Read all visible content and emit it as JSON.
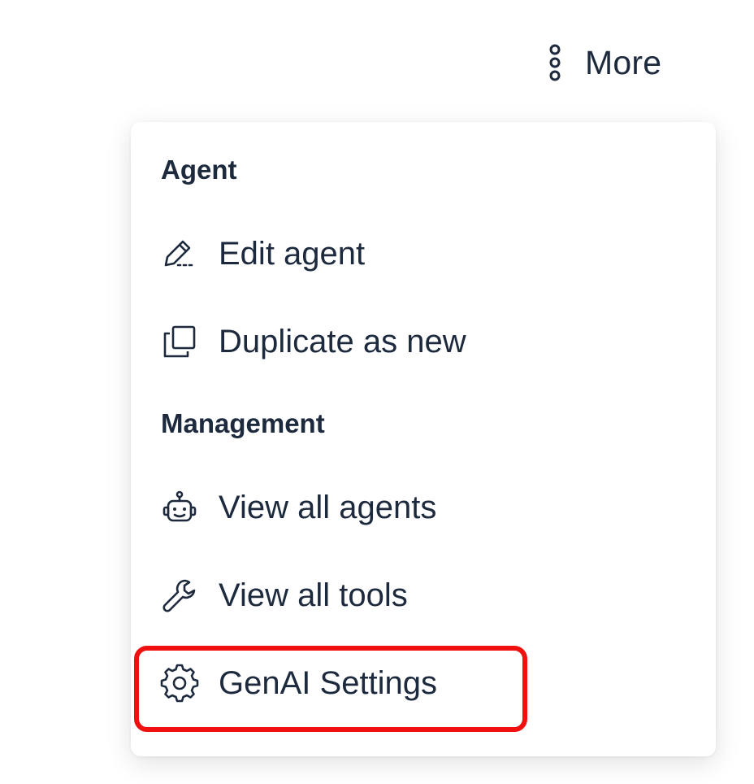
{
  "header": {
    "more_label": "More",
    "more_icon": "vertical-ellipsis-icon"
  },
  "menu": {
    "sections": [
      {
        "heading": "Agent",
        "items": [
          {
            "label": "Edit agent",
            "icon": "pencil-icon"
          },
          {
            "label": "Duplicate as new",
            "icon": "copy-icon"
          }
        ]
      },
      {
        "heading": "Management",
        "items": [
          {
            "label": "View all agents",
            "icon": "robot-icon"
          },
          {
            "label": "View all tools",
            "icon": "wrench-icon"
          },
          {
            "label": "GenAI Settings",
            "icon": "gear-icon"
          }
        ]
      }
    ]
  },
  "annotation": {
    "highlight_color": "#f01010",
    "highlighted_item": "GenAI Settings"
  },
  "colors": {
    "text": "#1d2a3e",
    "panel_bg": "#ffffff"
  }
}
